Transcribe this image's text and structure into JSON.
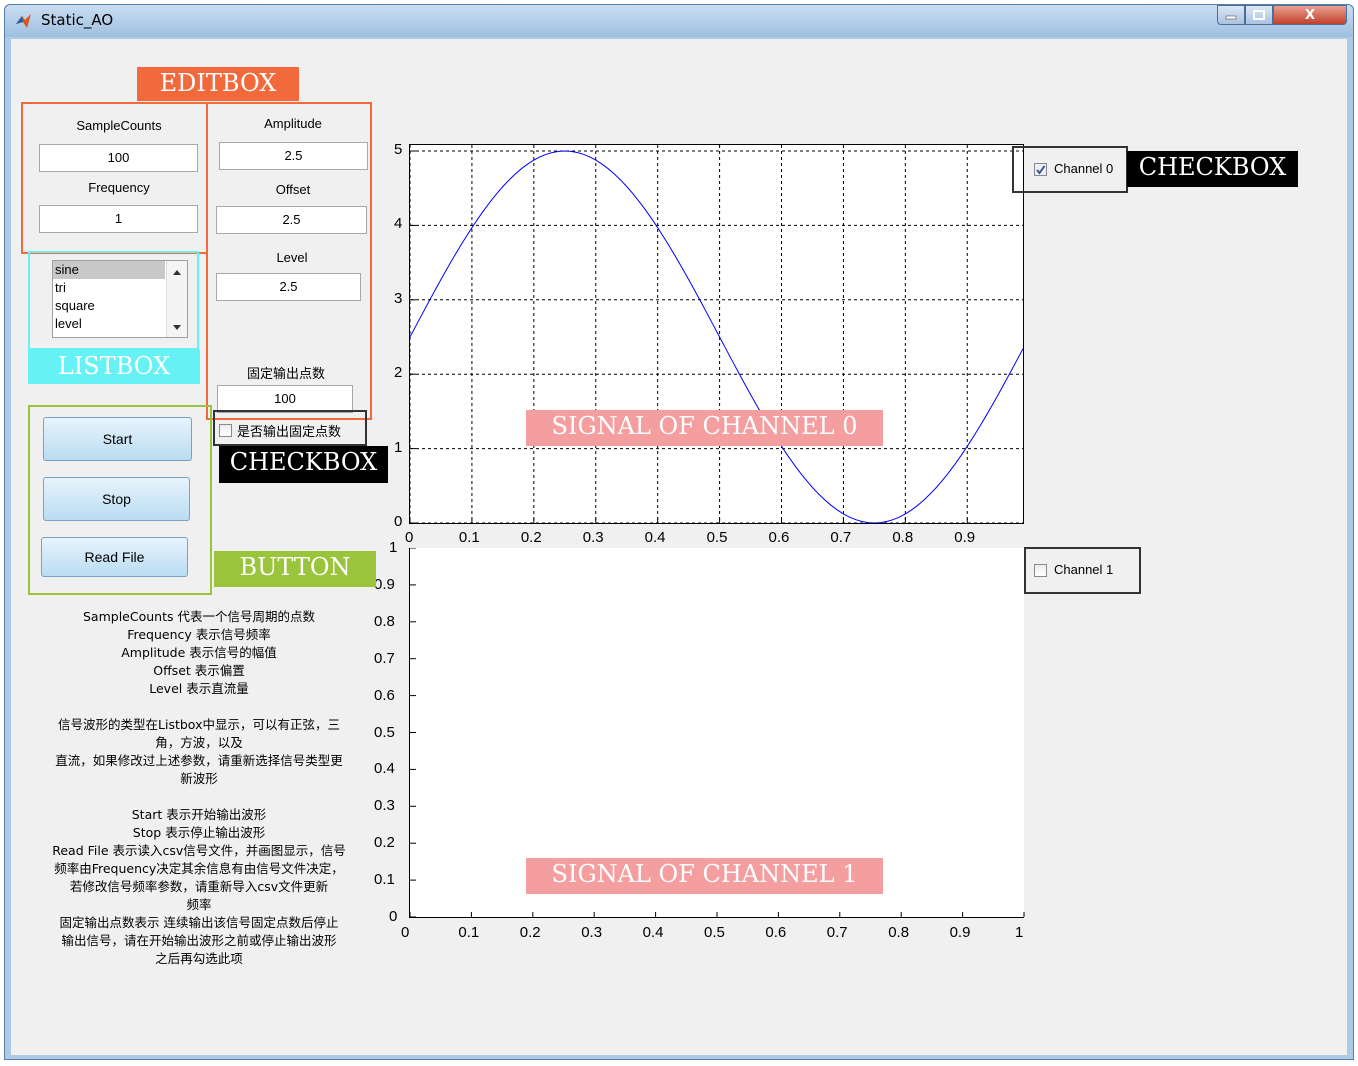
{
  "window": {
    "title": "Static_AO",
    "close_glyph": "X"
  },
  "fields": {
    "samplecounts": {
      "label": "SampleCounts",
      "value": "100"
    },
    "frequency": {
      "label": "Frequency",
      "value": "1"
    },
    "amplitude": {
      "label": "Amplitude",
      "value": "2.5"
    },
    "offset": {
      "label": "Offset",
      "value": "2.5"
    },
    "level": {
      "label": "Level",
      "value": "2.5"
    },
    "fixed_points": {
      "label": "固定输出点数",
      "value": "100"
    }
  },
  "waveform_list": {
    "items": [
      "sine",
      "tri",
      "square",
      "level"
    ],
    "selected": "sine"
  },
  "fixed_output_checkbox": {
    "label": "是否输出固定点数",
    "checked": false
  },
  "buttons": {
    "start": "Start",
    "stop": "Stop",
    "read_file": "Read File"
  },
  "channel_checkboxes": [
    {
      "label": "Channel 0",
      "checked": true
    },
    {
      "label": "Channel 1",
      "checked": false
    }
  ],
  "help_text": [
    "SampleCounts 代表一个信号周期的点数",
    "Frequency 表示信号频率",
    "Amplitude 表示信号的幅值",
    "Offset 表示偏置",
    "Level 表示直流量",
    "",
    "信号波形的类型在Listbox中显示，可以有正弦，三",
    "角，方波，以及",
    "直流，如果修改过上述参数，请重新选择信号类型更",
    "新波形",
    "",
    "Start 表示开始输出波形",
    "Stop 表示停止输出波形",
    "Read File 表示读入csv信号文件，并画图显示，信号",
    "频率由Frequency决定其余信息有由信号文件决定，",
    "若修改信号频率参数，请重新导入csv文件更新",
    "频率",
    "固定输出点数表示 连续输出该信号固定点数后停止",
    "输出信号，请在开始输出波形之前或停止输出波形",
    "之后再勾选此项"
  ],
  "annotations": {
    "editbox": "EDITBOX",
    "listbox": "LISTBOX",
    "checkbox_right": "CHECKBOX",
    "checkbox_left": "CHECKBOX",
    "button": "BUTTON",
    "signal0": "SIGNAL OF CHANNEL 0",
    "signal1": "SIGNAL OF CHANNEL 1"
  },
  "colors": {
    "editbox": "#f26a3c",
    "listbox": "#66f2f5",
    "button": "#9ac43b",
    "checkbox": "#000000",
    "signal_label": "#f59ea0",
    "trace": "#0000ff"
  },
  "chart_data": [
    {
      "type": "line",
      "name": "channel 0 plot",
      "x_ticks": [
        "0",
        "0.1",
        "0.2",
        "0.3",
        "0.4",
        "0.5",
        "0.6",
        "0.7",
        "0.8",
        "0.9"
      ],
      "y_ticks": [
        "0",
        "1",
        "2",
        "3",
        "4",
        "5"
      ],
      "xlim": [
        0,
        0.99
      ],
      "ylim": [
        0,
        5
      ],
      "grid": true,
      "series": [
        {
          "function": "2.5 + 2.5*sin(2*pi*x)",
          "x_start": 0,
          "x_end": 0.99,
          "points": 100
        }
      ]
    },
    {
      "type": "line",
      "name": "channel 1 plot",
      "x_ticks": [
        "0",
        "0.1",
        "0.2",
        "0.3",
        "0.4",
        "0.5",
        "0.6",
        "0.7",
        "0.8",
        "0.9",
        "1"
      ],
      "y_ticks": [
        "0",
        "0.1",
        "0.2",
        "0.3",
        "0.4",
        "0.5",
        "0.6",
        "0.7",
        "0.8",
        "0.9",
        "1"
      ],
      "xlim": [
        0,
        1
      ],
      "ylim": [
        0,
        1
      ],
      "grid": false,
      "series": []
    }
  ]
}
